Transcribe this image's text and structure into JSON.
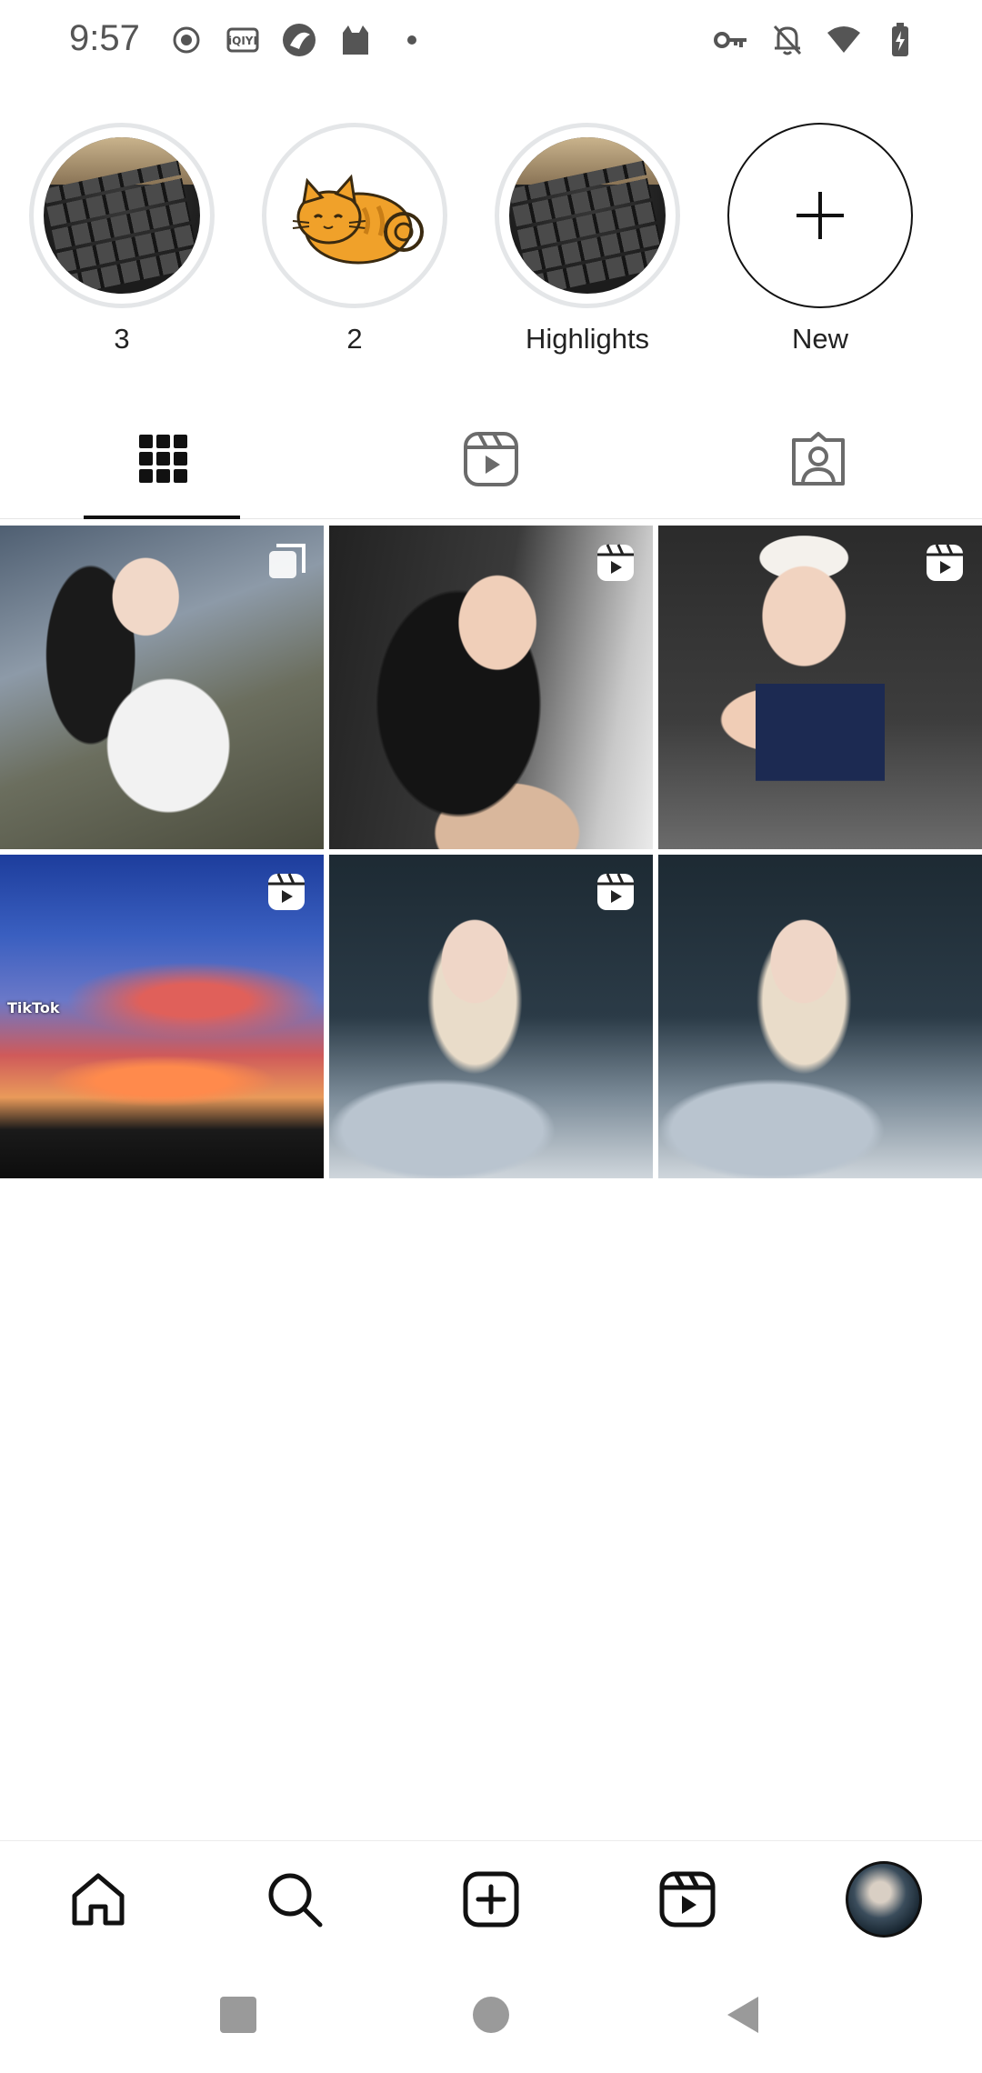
{
  "status_bar": {
    "time": "9:57",
    "left_icons": [
      "record-icon",
      "iqiyi-icon",
      "browser-icon",
      "cat-app-icon",
      "dot-icon"
    ],
    "right_icons": [
      "vpn-key-icon",
      "bell-off-icon",
      "wifi-icon",
      "battery-charging-icon"
    ],
    "iqiyi_label": "iQIYI"
  },
  "highlights": [
    {
      "label": "3",
      "image": "keyboard"
    },
    {
      "label": "2",
      "image": "cat-sticker"
    },
    {
      "label": "Highlights",
      "image": "keyboard"
    },
    {
      "label": "New",
      "image": "plus"
    }
  ],
  "tabs": [
    {
      "name": "grid",
      "icon": "grid-icon",
      "active": true
    },
    {
      "name": "reels",
      "icon": "reels-icon",
      "active": false
    },
    {
      "name": "tagged",
      "icon": "tagged-icon",
      "active": false
    }
  ],
  "grid_posts": [
    {
      "type": "carousel",
      "badge": "carousel-icon"
    },
    {
      "type": "reel",
      "badge": "reels-icon"
    },
    {
      "type": "reel",
      "badge": "reels-icon"
    },
    {
      "type": "reel",
      "badge": "reels-icon",
      "watermark": "TikTok"
    },
    {
      "type": "reel",
      "badge": "reels-icon"
    },
    {
      "type": "post",
      "badge": ""
    }
  ],
  "bottom_nav": [
    "home-icon",
    "search-icon",
    "create-icon",
    "reels-icon",
    "profile-avatar"
  ],
  "system_nav": [
    "recents-button",
    "home-button",
    "back-button"
  ],
  "colors": {
    "text": "#111111",
    "ring": "#e4e6e8",
    "cat": "#f0a12a"
  }
}
